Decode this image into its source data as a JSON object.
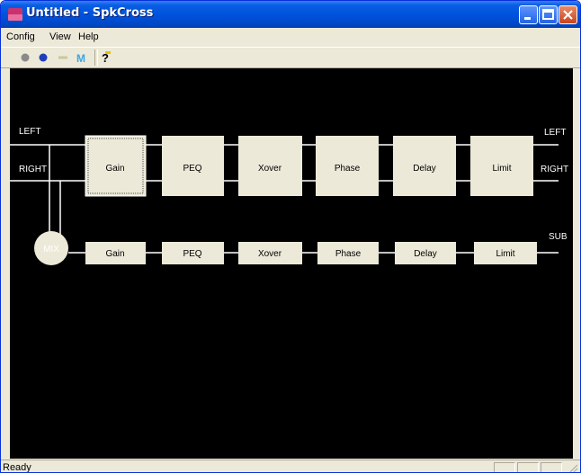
{
  "window": {
    "title": "Untitled - SpkCross"
  },
  "menu": {
    "items": [
      "Config",
      "View",
      "Help"
    ]
  },
  "toolbar": {
    "tools": [
      "gray-circle-icon",
      "blue-circle-icon",
      "dash-icon",
      "m-icon",
      "help-icon"
    ]
  },
  "diagram": {
    "labels": {
      "left_in": "LEFT",
      "right_in": "RIGHT",
      "left_out": "LEFT",
      "right_out": "RIGHT",
      "sub_out": "SUB",
      "mix": "MIX"
    },
    "main_blocks": [
      "Gain",
      "PEQ",
      "Xover",
      "Phase",
      "Delay",
      "Limit"
    ],
    "sub_blocks": [
      "Gain",
      "PEQ",
      "Xover",
      "Phase",
      "Delay",
      "Limit"
    ]
  },
  "status": {
    "text": "Ready"
  },
  "colors": {
    "block_fill": "#ece9d8",
    "canvas_bg": "#000000",
    "wire": "#ffffff"
  }
}
